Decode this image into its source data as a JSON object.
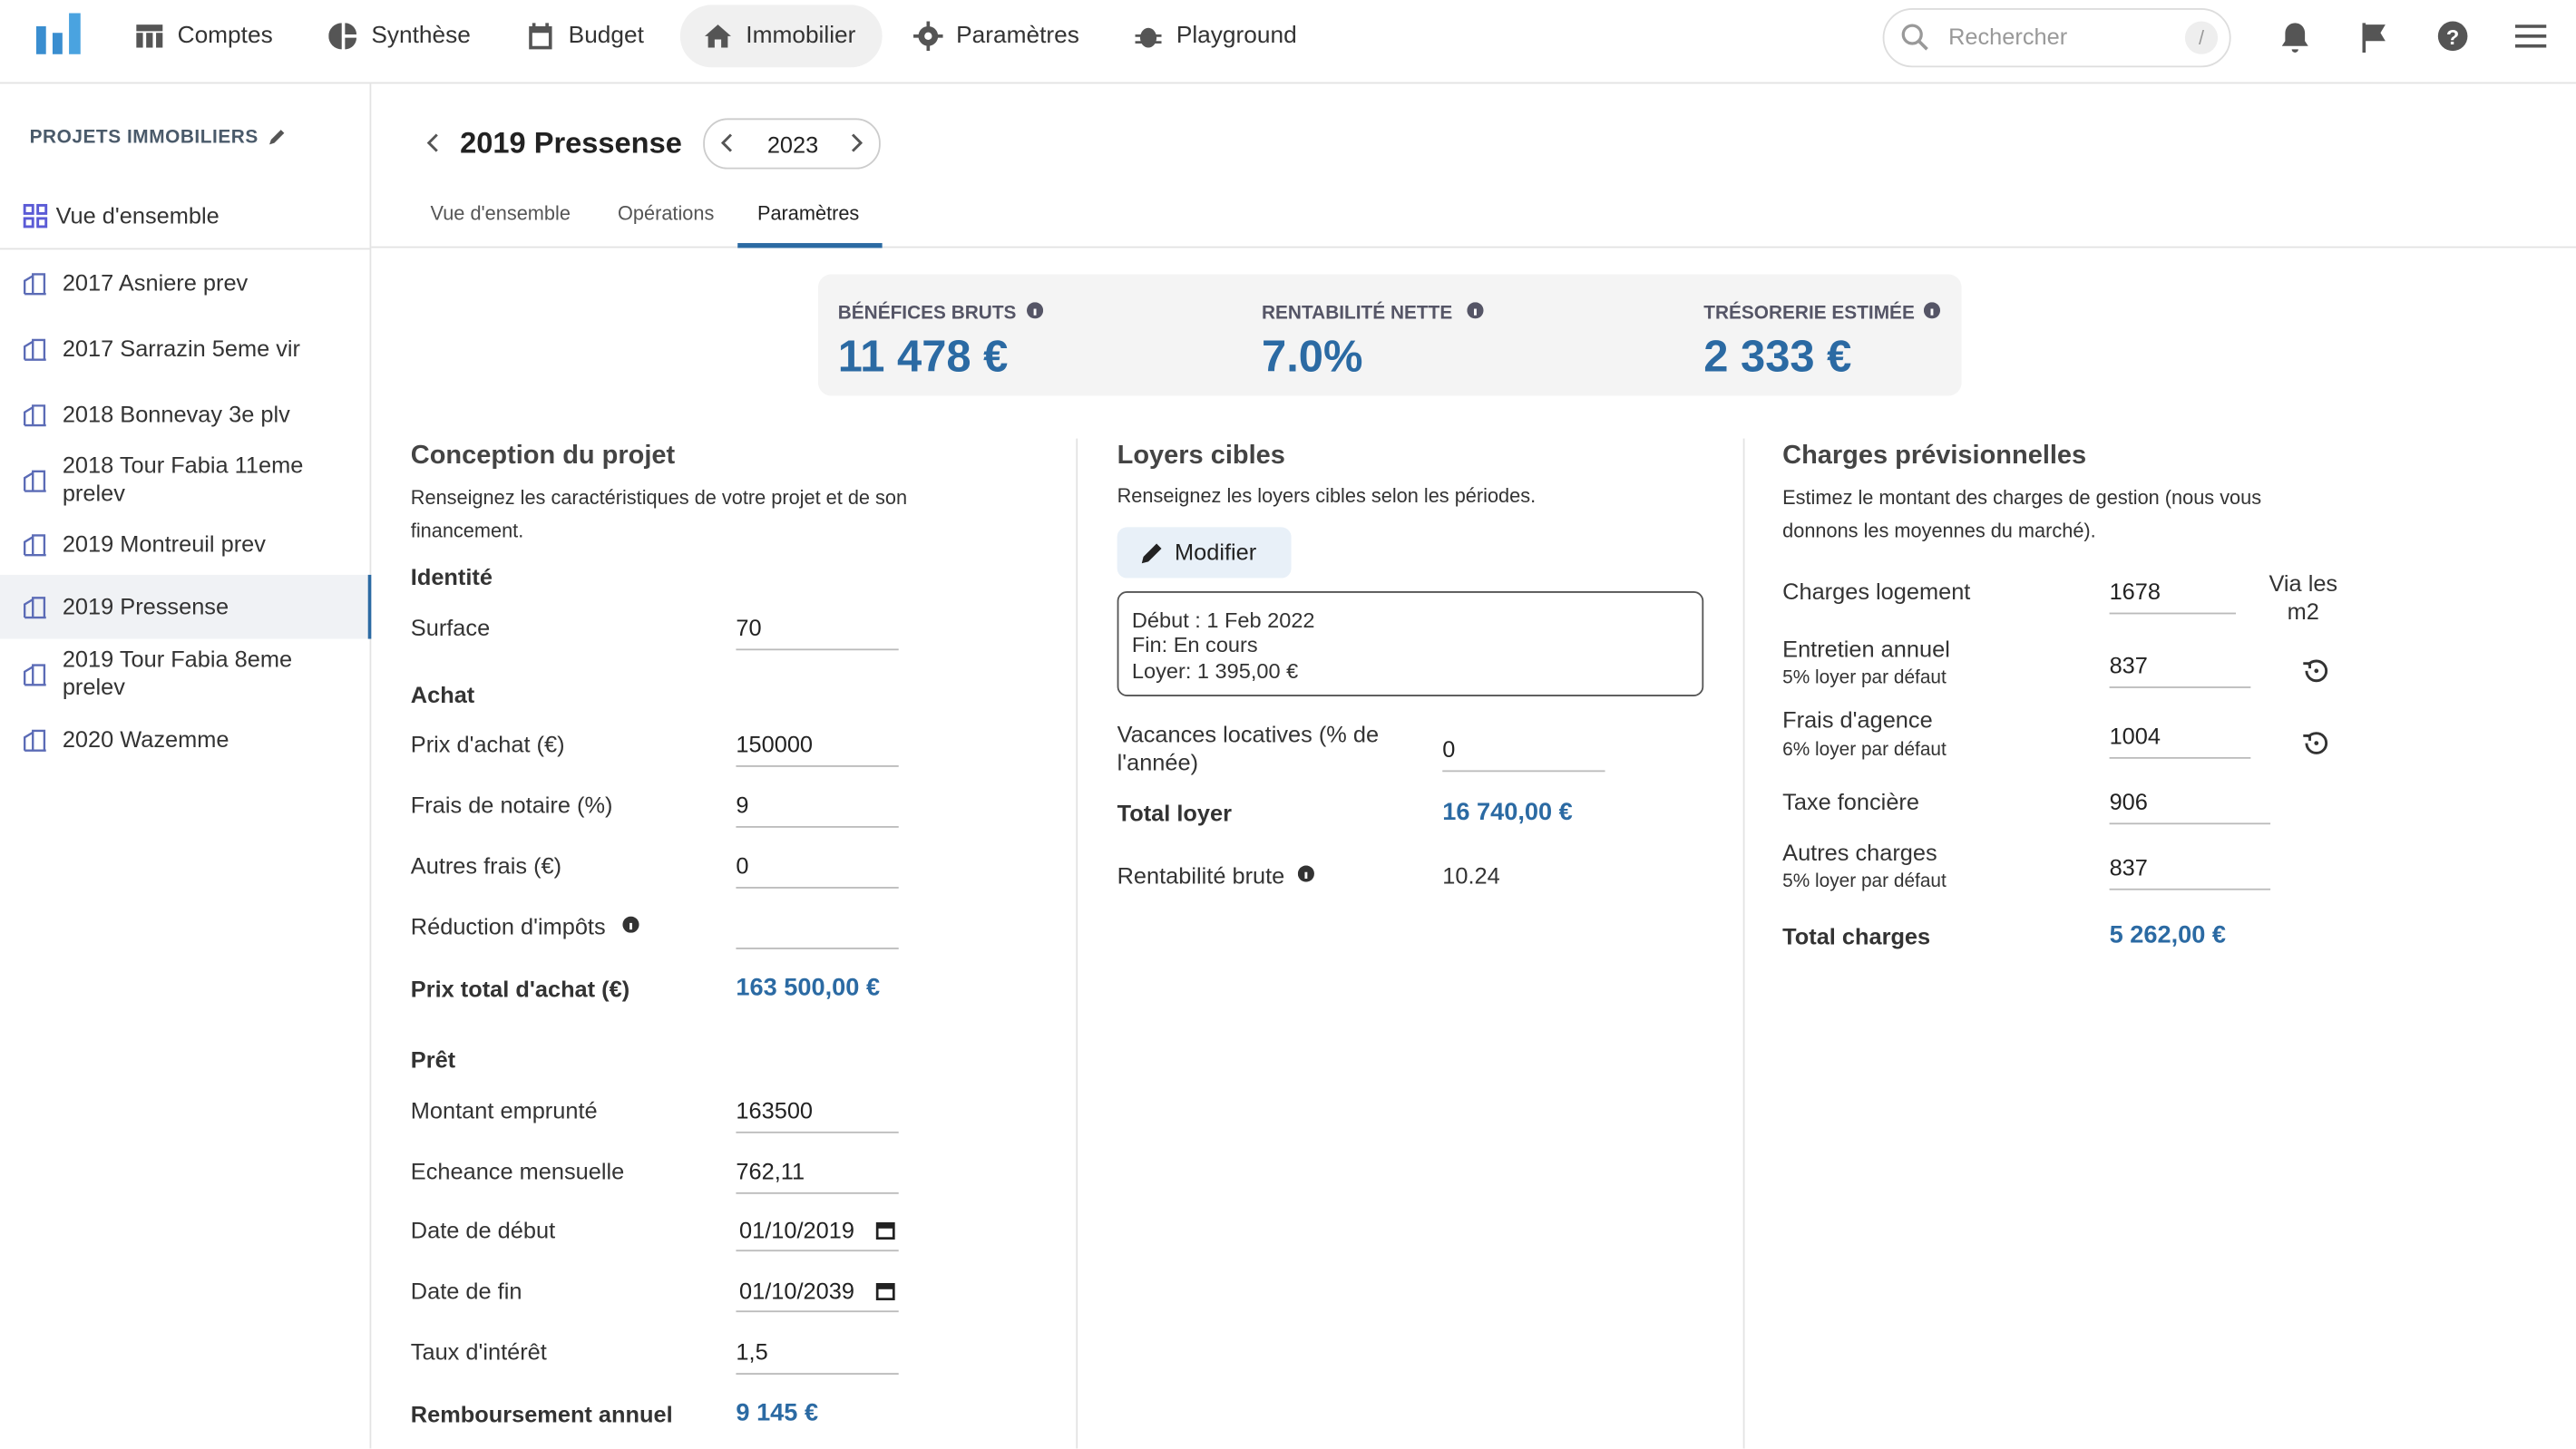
{
  "topnav": {
    "items": [
      {
        "label": "Comptes",
        "icon": "table-icon"
      },
      {
        "label": "Synthèse",
        "icon": "pie-chart-icon"
      },
      {
        "label": "Budget",
        "icon": "calendar-icon"
      },
      {
        "label": "Immobilier",
        "icon": "home-icon",
        "active": true
      },
      {
        "label": "Paramètres",
        "icon": "gear-icon"
      },
      {
        "label": "Playground",
        "icon": "bug-icon"
      }
    ],
    "search_placeholder": "Rechercher",
    "search_shortcut": "/"
  },
  "sidebar": {
    "title": "PROJETS IMMOBILIERS",
    "overview": "Vue d'ensemble",
    "projects": [
      "2017 Asniere prev",
      "2017 Sarrazin 5eme vir",
      "2018 Bonnevay 3e plv",
      "2018 Tour Fabia 11eme prelev",
      "2019 Montreuil prev",
      "2019 Pressense",
      "2019 Tour Fabia 8eme prelev",
      "2020 Wazemme"
    ],
    "selected": "2019 Pressense"
  },
  "header": {
    "title": "2019 Pressense",
    "year": "2023",
    "tabs": [
      "Vue d'ensemble",
      "Opérations",
      "Paramètres"
    ],
    "active_tab": "Paramètres"
  },
  "stats": [
    {
      "label": "BÉNÉFICES BRUTS",
      "value": "11 478 €"
    },
    {
      "label": "RENTABILITÉ NETTE",
      "value": "7.0%"
    },
    {
      "label": "TRÉSORERIE ESTIMÉE",
      "value": "2 333 €"
    }
  ],
  "conception": {
    "title": "Conception du projet",
    "desc": "Renseignez les caractéristiques de votre projet et de son financement.",
    "identite": "Identité",
    "surface_label": "Surface",
    "surface": "70",
    "achat": "Achat",
    "prix_label": "Prix d'achat (€)",
    "prix": "150000",
    "notaire_label": "Frais de notaire (%)",
    "notaire": "9",
    "autres_label": "Autres frais (€)",
    "autres": "0",
    "reduction_label": "Réduction d'impôts",
    "reduction": "",
    "total_label": "Prix total d'achat (€)",
    "total": "163 500,00 €",
    "pret": "Prêt",
    "montant_label": "Montant emprunté",
    "montant": "163500",
    "echeance_label": "Echeance mensuelle",
    "echeance": "762,11",
    "debut_label": "Date de début",
    "debut": "01/10/2019",
    "fin_label": "Date de fin",
    "fin": "01/10/2039",
    "taux_label": "Taux d'intérêt",
    "taux": "1,5",
    "remb_label": "Remboursement annuel",
    "remb": "9 145 €"
  },
  "loyers": {
    "title": "Loyers cibles",
    "desc": "Renseignez les loyers cibles selon les périodes.",
    "modifier": "Modifier",
    "period": {
      "debut": "Début : 1 Feb 2022",
      "fin": "Fin: En cours",
      "loyer": "Loyer: 1 395,00 €"
    },
    "vacances_label": "Vacances locatives (% de l'année)",
    "vacances": "0",
    "total_label": "Total loyer",
    "total": "16 740,00 €",
    "rent_label": "Rentabilité brute",
    "rent": "10.24"
  },
  "charges": {
    "title": "Charges prévisionnelles",
    "desc": "Estimez le montant des charges de gestion (nous vous donnons les moyennes du marché).",
    "logement_label": "Charges logement",
    "logement": "1678",
    "via": "Via les m2",
    "entretien_label": "Entretien annuel",
    "entretien_sub": "5% loyer par défaut",
    "entretien": "837",
    "agence_label": "Frais d'agence",
    "agence_sub": "6% loyer par défaut",
    "agence": "1004",
    "taxe_label": "Taxe foncière",
    "taxe": "906",
    "autres_label": "Autres charges",
    "autres_sub": "5% loyer par défaut",
    "autres": "837",
    "total_label": "Total charges",
    "total": "5 262,00 €"
  },
  "colors": {
    "accent": "#2b6aa3"
  }
}
